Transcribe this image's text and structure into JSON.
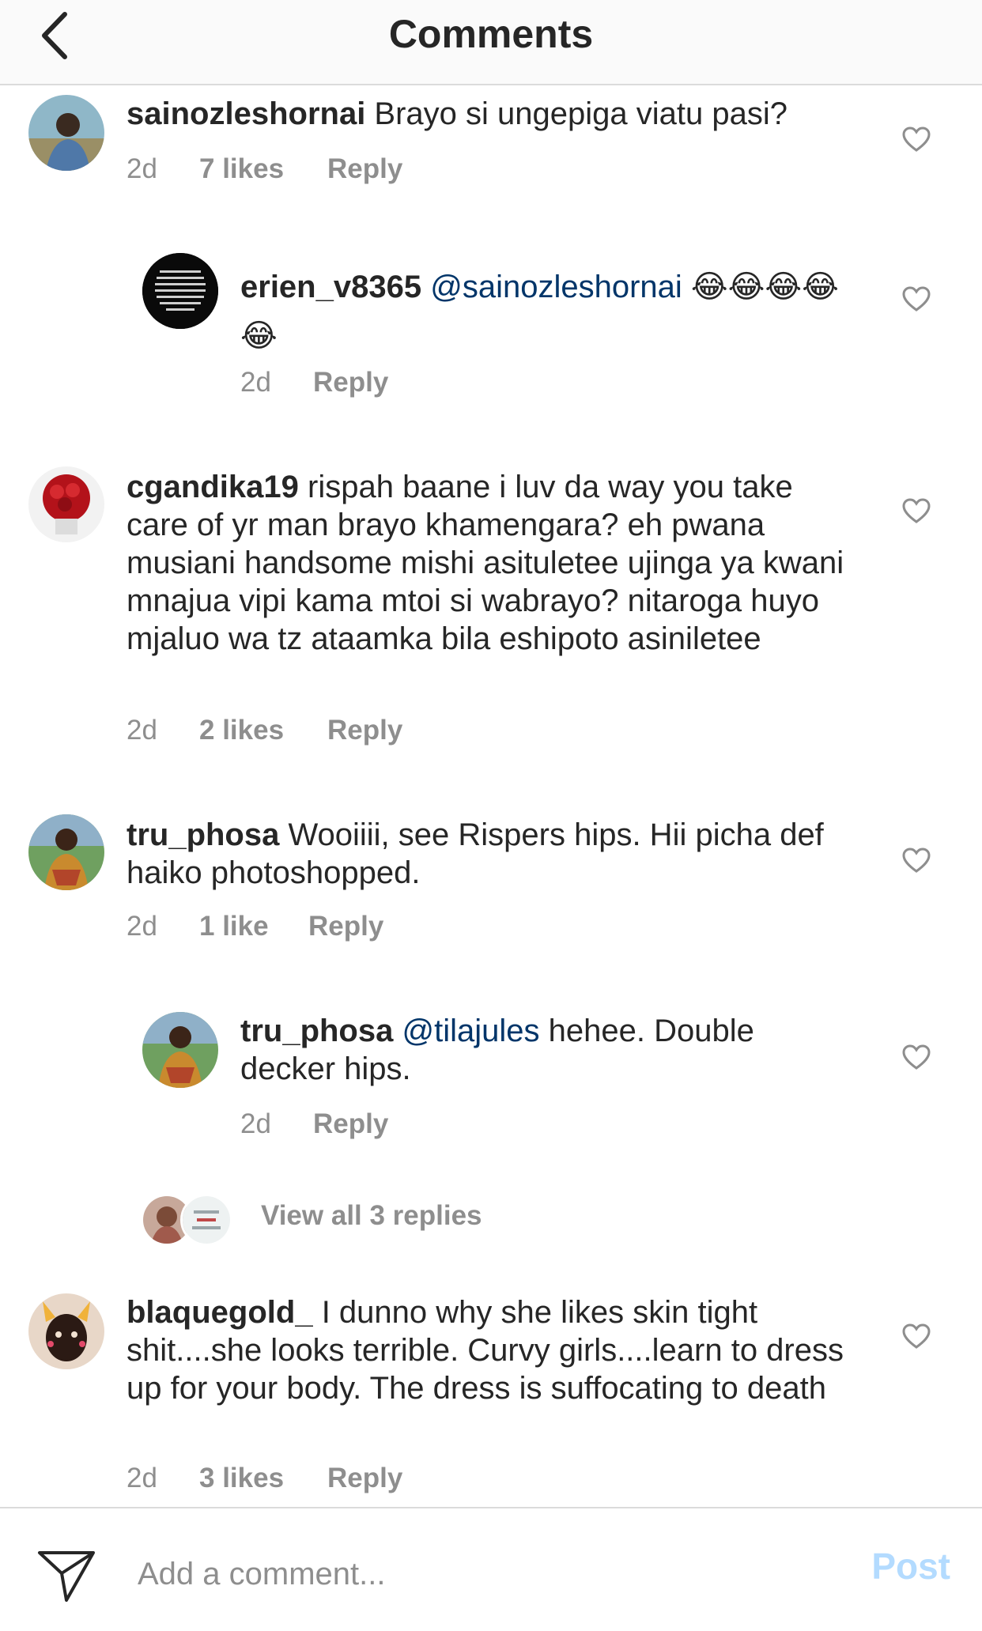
{
  "header": {
    "title": "Comments"
  },
  "comments": [
    {
      "username": "sainozleshornai",
      "text": " Brayo si ungepiga viatu pasi?",
      "time": "2d",
      "likes": "7 likes",
      "reply": "Reply"
    },
    {
      "username": "erien_v8365",
      "mention": "@sainozleshornai",
      "text": " 😂😂😂😂😂",
      "time": "2d",
      "reply": "Reply"
    },
    {
      "username": "cgandika19",
      "text": " rispah baane i luv da way you take care of yr man brayo khamengara? eh pwana musiani handsome mishi asituletee ujinga ya kwani mnajua vipi kama mtoi si wabrayo? nitaroga huyo mjaluo wa tz ataamka bila eshipoto asiniletee",
      "time": "2d",
      "likes": "2 likes",
      "reply": "Reply"
    },
    {
      "username": "tru_phosa",
      "text": " Wooiiii, see Rispers hips. Hii picha def haiko photoshopped.",
      "time": "2d",
      "likes": "1 like",
      "reply": "Reply"
    },
    {
      "username": "tru_phosa",
      "mention": "@tilajules",
      "text": " hehee. Double decker hips.",
      "time": "2d",
      "reply": "Reply"
    },
    {
      "username": "blaquegold_",
      "text": " I dunno why she likes skin tight shit....she looks terrible. Curvy girls....learn to dress up for your body. The dress is suffocating to death",
      "time": "2d",
      "likes": "3 likes",
      "reply": "Reply"
    }
  ],
  "view_replies": "View all 3 replies",
  "footer": {
    "placeholder": "Add a comment...",
    "post_label": "Post"
  },
  "colors": {
    "mention": "#003569",
    "meta": "#8e8e8e",
    "post_disabled": "#b3dbff"
  },
  "icons": {
    "back": "chevron-left-icon",
    "like": "heart-outline-icon",
    "send": "paper-plane-icon"
  }
}
